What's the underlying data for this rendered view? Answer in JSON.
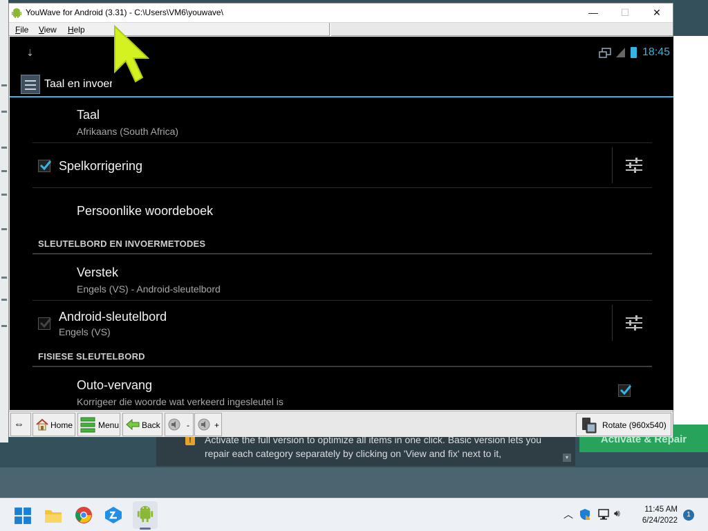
{
  "window": {
    "title": "YouWave for Android (3.31) - C:\\Users\\VM6\\youwave\\",
    "minimize": "—",
    "maximize": "☐",
    "close": "✕"
  },
  "menu": {
    "file": "File",
    "view": "View",
    "help": "Help"
  },
  "android": {
    "status": {
      "download_icon": "⇣",
      "time": "18:45"
    },
    "actionbar_title": "Taal en invoer",
    "prefs": {
      "taal": {
        "title": "Taal",
        "summary": "Afrikaans (South Africa)"
      },
      "spell": {
        "title": "Spelkorrigering",
        "checked": true
      },
      "dict": {
        "title": "Persoonlike woordeboek"
      },
      "cat_keyboard": "SLEUTELBORD EN INVOERMETODES",
      "default": {
        "title": "Verstek",
        "summary": "Engels (VS) - Android-sleutelbord"
      },
      "android_kb": {
        "title": "Android-sleutelbord",
        "summary": "Engels (VS)",
        "checked": true
      },
      "cat_physical": "FISIESE SLEUTELBORD",
      "auto_replace": {
        "title": "Outo-vervang",
        "summary": "Korrigeer die woorde wat verkeerd ingesleutel is",
        "checked": true
      }
    }
  },
  "toolbar": {
    "arrows": "⇔",
    "home": "Home",
    "menu": "Menu",
    "back": "Back",
    "vol_down": "-",
    "vol_up": "+",
    "rotate": "Rotate (960x540)"
  },
  "background": {
    "warn_icon": "!",
    "message": "Activate the full version to optimize all items in one click. Basic version lets you repair each category separately by clicking on 'View and fix' next to it,",
    "activate": "Activate & Repair",
    "scroll_arrow": "▾"
  },
  "taskbar": {
    "time": "11:45 AM",
    "date": "6/24/2022",
    "notifications": "1",
    "tray_chevron": "︿",
    "volume_icon": "🔊︎"
  },
  "colors": {
    "accent": "#33b5e5",
    "toolbar": "#e8e8e8",
    "cursor": "#d4f21f"
  }
}
